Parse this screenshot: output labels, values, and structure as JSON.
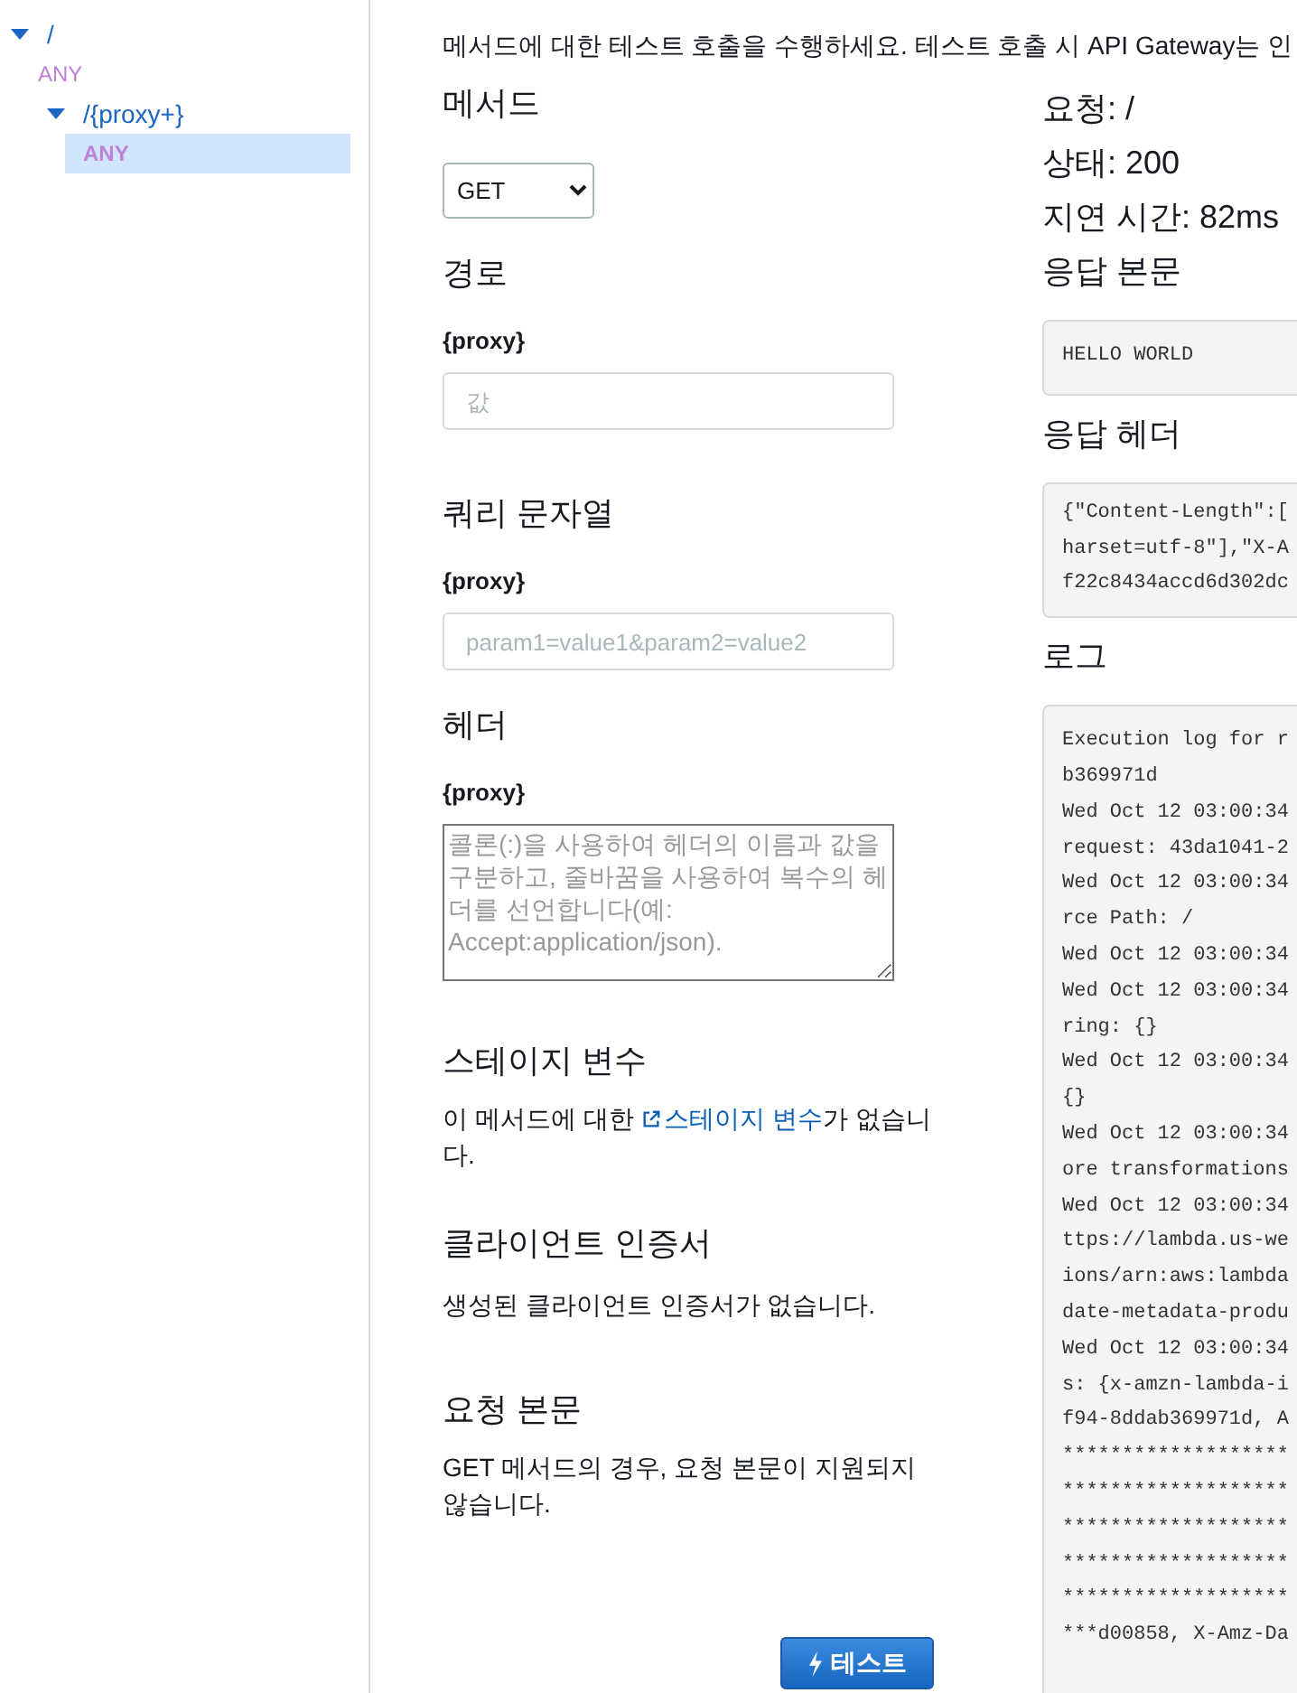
{
  "sidebar": {
    "tree": [
      {
        "label": "/",
        "kind": "resource",
        "expanded": true,
        "children": [
          {
            "label": "ANY",
            "kind": "method",
            "selected": false
          },
          {
            "label": "/{proxy+}",
            "kind": "resource",
            "expanded": true,
            "children": [
              {
                "label": "ANY",
                "kind": "method",
                "selected": true
              }
            ]
          }
        ]
      }
    ]
  },
  "intro": "메서드에 대한 테스트 호출을 수행하세요. 테스트 호출 시 API Gateway는 인",
  "form": {
    "method": {
      "heading": "메서드",
      "value": "GET"
    },
    "path": {
      "heading": "경로",
      "param_label": "{proxy}",
      "placeholder": "값"
    },
    "query": {
      "heading": "쿼리 문자열",
      "param_label": "{proxy}",
      "placeholder": "param1=value1&param2=value2"
    },
    "headers": {
      "heading": "헤더",
      "param_label": "{proxy}",
      "placeholder": "콜론(:)을 사용하여 헤더의 이름과 값을 구분하고, 줄바꿈을 사용하여 복수의 헤더를 선언합니다(예: Accept:application/json)."
    },
    "stage_variables": {
      "heading": "스테이지 변수",
      "text_before": "이 메서드에 대한 ",
      "link": "스테이지 변수",
      "text_after": "가 없습니다."
    },
    "client_certificate": {
      "heading": "클라이언트 인증서",
      "text": "생성된 클라이언트 인증서가 없습니다."
    },
    "request_body": {
      "heading": "요청 본문",
      "text": "GET 메서드의 경우, 요청 본문이 지원되지 않습니다."
    },
    "test_button": "테스트"
  },
  "result": {
    "request": "요청: /",
    "status": "상태: 200",
    "latency": "지연 시간: 82ms",
    "response_body": {
      "heading": "응답 본문",
      "lines": [
        "HELLO WORLD"
      ]
    },
    "response_headers": {
      "heading": "응답 헤더",
      "lines": [
        "{\"Content-Length\":[",
        "harset=utf-8\"],\"X-A",
        "f22c8434accd6d302dc"
      ]
    },
    "logs": {
      "heading": "로그",
      "lines": [
        "Execution log for r",
        "b369971d",
        "Wed Oct 12 03:00:34",
        "request: 43da1041-2",
        "Wed Oct 12 03:00:34",
        "rce Path: /",
        "Wed Oct 12 03:00:34",
        "Wed Oct 12 03:00:34",
        "ring: {}",
        "Wed Oct 12 03:00:34",
        "{}",
        "Wed Oct 12 03:00:34",
        "ore transformations",
        "Wed Oct 12 03:00:34",
        "ttps://lambda.us-we",
        "ions/arn:aws:lambda",
        "date-metadata-produ",
        "Wed Oct 12 03:00:34",
        "s: {x-amzn-lambda-i",
        "f94-8ddab369971d, A",
        "*******************",
        "*******************",
        "*******************",
        "*******************",
        "*******************",
        "***d00858, X-Amz-Da"
      ]
    }
  }
}
